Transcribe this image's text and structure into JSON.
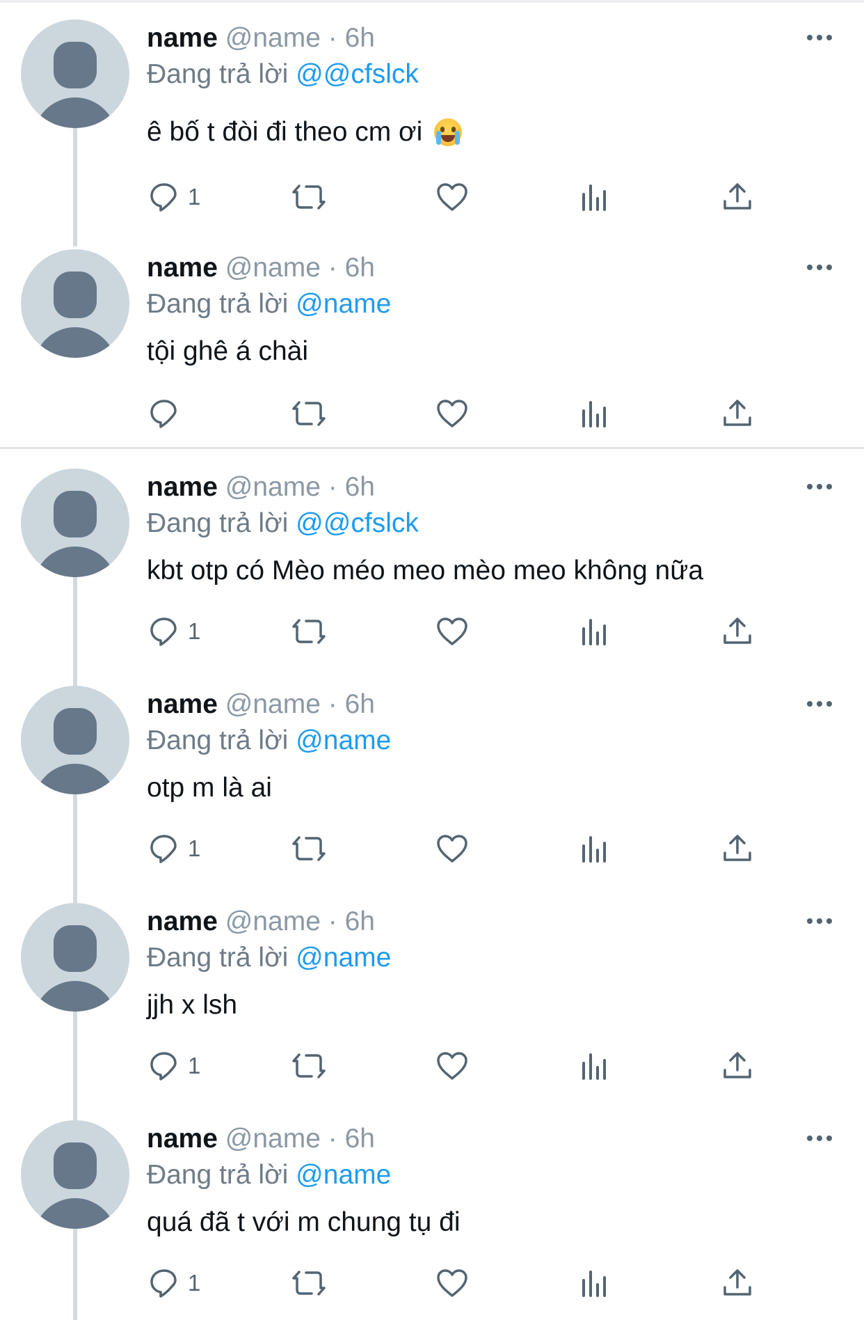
{
  "colors": {
    "mention": "#1d9bf0",
    "text": "#0f1419",
    "secondary": "#8b98a5",
    "icon": "#536471"
  },
  "threads": [
    {
      "tweets": [
        {
          "name": "name",
          "handle": "@name",
          "dot": "·",
          "time": "6h",
          "reply_prefix": "Đang trả lời",
          "reply_to": "@@cfslck",
          "text": "ê bố t đòi đi theo cm ơi",
          "emoji": "loudly-crying-face",
          "reply_count": "1"
        },
        {
          "name": "name",
          "handle": "@name",
          "dot": "·",
          "time": "6h",
          "reply_prefix": "Đang trả lời",
          "reply_to": "@name",
          "text": "tội ghê á chài",
          "reply_count": ""
        }
      ]
    },
    {
      "tweets": [
        {
          "name": "name",
          "handle": "@name",
          "dot": "·",
          "time": "6h",
          "reply_prefix": "Đang trả lời",
          "reply_to": "@@cfslck",
          "text": "kbt otp có Mèo méo meo mèo meo không nữa",
          "reply_count": "1"
        },
        {
          "name": "name",
          "handle": "@name",
          "dot": "·",
          "time": "6h",
          "reply_prefix": "Đang trả lời",
          "reply_to": "@name",
          "text": "otp m là ai",
          "reply_count": "1"
        },
        {
          "name": "name",
          "handle": "@name",
          "dot": "·",
          "time": "6h",
          "reply_prefix": "Đang trả lời",
          "reply_to": "@name",
          "text": "jjh x lsh",
          "reply_count": "1"
        },
        {
          "name": "name",
          "handle": "@name",
          "dot": "·",
          "time": "6h",
          "reply_prefix": "Đang trả lời",
          "reply_to": "@name",
          "text": "quá đã t với m chung tụ đi",
          "reply_count": "1"
        }
      ]
    }
  ]
}
